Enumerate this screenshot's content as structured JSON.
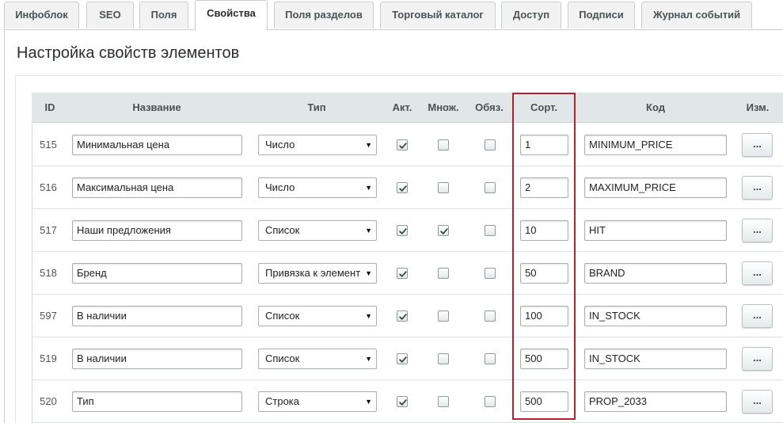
{
  "tabs": [
    {
      "label": "Инфоблок"
    },
    {
      "label": "SEO"
    },
    {
      "label": "Поля"
    },
    {
      "label": "Свойства",
      "active": true
    },
    {
      "label": "Поля разделов"
    },
    {
      "label": "Торговый каталог"
    },
    {
      "label": "Доступ"
    },
    {
      "label": "Подписи"
    },
    {
      "label": "Журнал событий"
    }
  ],
  "section_title": "Настройка свойств элементов",
  "columns": {
    "id": "ID",
    "name": "Название",
    "type": "Тип",
    "active": "Акт.",
    "multiple": "Множ.",
    "required": "Обяз.",
    "sort": "Сорт.",
    "code": "Код",
    "edit": "Изм."
  },
  "rows": [
    {
      "id": "515",
      "name": "Минимальная цена",
      "type": "Число",
      "active": true,
      "multiple": false,
      "required": false,
      "sort": "1",
      "code": "MINIMUM_PRICE",
      "edit": "..."
    },
    {
      "id": "516",
      "name": "Максимальная цена",
      "type": "Число",
      "active": true,
      "multiple": false,
      "required": false,
      "sort": "2",
      "code": "MAXIMUM_PRICE",
      "edit": "..."
    },
    {
      "id": "517",
      "name": "Наши предложения",
      "type": "Список",
      "active": true,
      "multiple": true,
      "required": false,
      "sort": "10",
      "code": "HIT",
      "edit": "..."
    },
    {
      "id": "518",
      "name": "Бренд",
      "type": "Привязка к элемент",
      "active": true,
      "multiple": false,
      "required": false,
      "sort": "50",
      "code": "BRAND",
      "edit": "..."
    },
    {
      "id": "597",
      "name": "В наличии",
      "type": "Список",
      "active": true,
      "multiple": false,
      "required": false,
      "sort": "100",
      "code": "IN_STOCK",
      "edit": "..."
    },
    {
      "id": "519",
      "name": "В наличии",
      "type": "Список",
      "active": true,
      "multiple": false,
      "required": false,
      "sort": "500",
      "code": "IN_STOCK",
      "edit": "..."
    },
    {
      "id": "520",
      "name": "Тип",
      "type": "Строка",
      "active": true,
      "multiple": false,
      "required": false,
      "sort": "500",
      "code": "PROP_2033",
      "edit": "..."
    }
  ],
  "colors": {
    "header_bg": "#e1e7e8",
    "highlight_border": "#b3232c",
    "tab_bg": "#f2f2f2"
  },
  "icons": {
    "checkbox_checked": "check-icon",
    "select_arrow": "triangle-down-icon"
  }
}
